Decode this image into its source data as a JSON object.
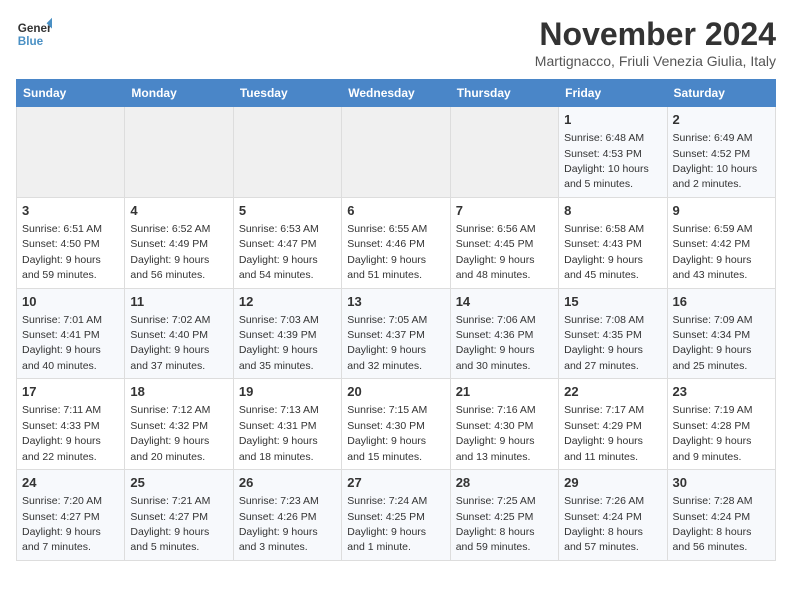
{
  "header": {
    "logo_line1": "General",
    "logo_line2": "Blue",
    "month": "November 2024",
    "location": "Martignacco, Friuli Venezia Giulia, Italy"
  },
  "weekdays": [
    "Sunday",
    "Monday",
    "Tuesday",
    "Wednesday",
    "Thursday",
    "Friday",
    "Saturday"
  ],
  "weeks": [
    [
      {
        "day": "",
        "detail": ""
      },
      {
        "day": "",
        "detail": ""
      },
      {
        "day": "",
        "detail": ""
      },
      {
        "day": "",
        "detail": ""
      },
      {
        "day": "",
        "detail": ""
      },
      {
        "day": "1",
        "detail": "Sunrise: 6:48 AM\nSunset: 4:53 PM\nDaylight: 10 hours and 5 minutes."
      },
      {
        "day": "2",
        "detail": "Sunrise: 6:49 AM\nSunset: 4:52 PM\nDaylight: 10 hours and 2 minutes."
      }
    ],
    [
      {
        "day": "3",
        "detail": "Sunrise: 6:51 AM\nSunset: 4:50 PM\nDaylight: 9 hours and 59 minutes."
      },
      {
        "day": "4",
        "detail": "Sunrise: 6:52 AM\nSunset: 4:49 PM\nDaylight: 9 hours and 56 minutes."
      },
      {
        "day": "5",
        "detail": "Sunrise: 6:53 AM\nSunset: 4:47 PM\nDaylight: 9 hours and 54 minutes."
      },
      {
        "day": "6",
        "detail": "Sunrise: 6:55 AM\nSunset: 4:46 PM\nDaylight: 9 hours and 51 minutes."
      },
      {
        "day": "7",
        "detail": "Sunrise: 6:56 AM\nSunset: 4:45 PM\nDaylight: 9 hours and 48 minutes."
      },
      {
        "day": "8",
        "detail": "Sunrise: 6:58 AM\nSunset: 4:43 PM\nDaylight: 9 hours and 45 minutes."
      },
      {
        "day": "9",
        "detail": "Sunrise: 6:59 AM\nSunset: 4:42 PM\nDaylight: 9 hours and 43 minutes."
      }
    ],
    [
      {
        "day": "10",
        "detail": "Sunrise: 7:01 AM\nSunset: 4:41 PM\nDaylight: 9 hours and 40 minutes."
      },
      {
        "day": "11",
        "detail": "Sunrise: 7:02 AM\nSunset: 4:40 PM\nDaylight: 9 hours and 37 minutes."
      },
      {
        "day": "12",
        "detail": "Sunrise: 7:03 AM\nSunset: 4:39 PM\nDaylight: 9 hours and 35 minutes."
      },
      {
        "day": "13",
        "detail": "Sunrise: 7:05 AM\nSunset: 4:37 PM\nDaylight: 9 hours and 32 minutes."
      },
      {
        "day": "14",
        "detail": "Sunrise: 7:06 AM\nSunset: 4:36 PM\nDaylight: 9 hours and 30 minutes."
      },
      {
        "day": "15",
        "detail": "Sunrise: 7:08 AM\nSunset: 4:35 PM\nDaylight: 9 hours and 27 minutes."
      },
      {
        "day": "16",
        "detail": "Sunrise: 7:09 AM\nSunset: 4:34 PM\nDaylight: 9 hours and 25 minutes."
      }
    ],
    [
      {
        "day": "17",
        "detail": "Sunrise: 7:11 AM\nSunset: 4:33 PM\nDaylight: 9 hours and 22 minutes."
      },
      {
        "day": "18",
        "detail": "Sunrise: 7:12 AM\nSunset: 4:32 PM\nDaylight: 9 hours and 20 minutes."
      },
      {
        "day": "19",
        "detail": "Sunrise: 7:13 AM\nSunset: 4:31 PM\nDaylight: 9 hours and 18 minutes."
      },
      {
        "day": "20",
        "detail": "Sunrise: 7:15 AM\nSunset: 4:30 PM\nDaylight: 9 hours and 15 minutes."
      },
      {
        "day": "21",
        "detail": "Sunrise: 7:16 AM\nSunset: 4:30 PM\nDaylight: 9 hours and 13 minutes."
      },
      {
        "day": "22",
        "detail": "Sunrise: 7:17 AM\nSunset: 4:29 PM\nDaylight: 9 hours and 11 minutes."
      },
      {
        "day": "23",
        "detail": "Sunrise: 7:19 AM\nSunset: 4:28 PM\nDaylight: 9 hours and 9 minutes."
      }
    ],
    [
      {
        "day": "24",
        "detail": "Sunrise: 7:20 AM\nSunset: 4:27 PM\nDaylight: 9 hours and 7 minutes."
      },
      {
        "day": "25",
        "detail": "Sunrise: 7:21 AM\nSunset: 4:27 PM\nDaylight: 9 hours and 5 minutes."
      },
      {
        "day": "26",
        "detail": "Sunrise: 7:23 AM\nSunset: 4:26 PM\nDaylight: 9 hours and 3 minutes."
      },
      {
        "day": "27",
        "detail": "Sunrise: 7:24 AM\nSunset: 4:25 PM\nDaylight: 9 hours and 1 minute."
      },
      {
        "day": "28",
        "detail": "Sunrise: 7:25 AM\nSunset: 4:25 PM\nDaylight: 8 hours and 59 minutes."
      },
      {
        "day": "29",
        "detail": "Sunrise: 7:26 AM\nSunset: 4:24 PM\nDaylight: 8 hours and 57 minutes."
      },
      {
        "day": "30",
        "detail": "Sunrise: 7:28 AM\nSunset: 4:24 PM\nDaylight: 8 hours and 56 minutes."
      }
    ]
  ]
}
